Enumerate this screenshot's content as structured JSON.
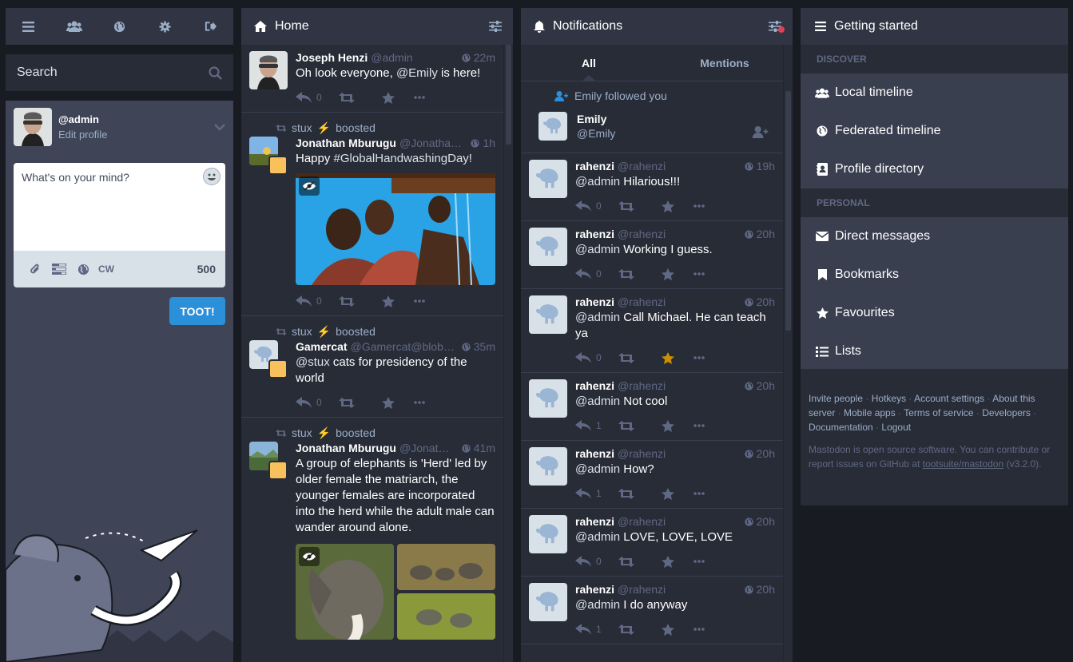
{
  "compose": {
    "search_placeholder": "Search",
    "account_username": "@admin",
    "edit_profile": "Edit profile",
    "textarea_placeholder": "What's on your mind?",
    "cw_label": "CW",
    "char_count": "500",
    "toot_label": "TOOT!"
  },
  "home": {
    "title": "Home",
    "statuses": [
      {
        "boost": null,
        "name": "Joseph Henzi",
        "acct": "@admin",
        "time": "22m",
        "content": "Oh look everyone, @Emily is here!",
        "replies": "0"
      },
      {
        "boost": "stux",
        "boosted_label": "boosted",
        "name": "Jonathan Mburugu",
        "acct": "@Jonathan…",
        "time": "1h",
        "content": "Happy #GlobalHandwashingDay!",
        "replies": "0"
      },
      {
        "boost": "stux",
        "boosted_label": "boosted",
        "name": "Gamercat",
        "acct": "@Gamercat@blob....",
        "time": "35m",
        "content": "@stux cats for presidency of the world",
        "replies": "0"
      },
      {
        "boost": "stux",
        "boosted_label": "boosted",
        "name": "Jonathan Mburugu",
        "acct": "@Jonath…",
        "time": "41m",
        "content": "A group of elephants is 'Herd' led by older female the matriarch, the younger females are incorporated into the herd while the adult male can wander around alone."
      }
    ]
  },
  "notifications": {
    "title": "Notifications",
    "tab_all": "All",
    "tab_mentions": "Mentions",
    "follow_text": "Emily followed you",
    "follower_name": "Emily",
    "follower_handle": "@Emily",
    "items": [
      {
        "name": "rahenzi",
        "acct": "@rahenzi",
        "time": "19h",
        "content": "@admin Hilarious!!!",
        "replies": "0",
        "fav": false
      },
      {
        "name": "rahenzi",
        "acct": "@rahenzi",
        "time": "20h",
        "content": "@admin Working I guess.",
        "replies": "0",
        "fav": false
      },
      {
        "name": "rahenzi",
        "acct": "@rahenzi",
        "time": "20h",
        "content": "@admin Call Michael. He can teach ya",
        "replies": "0",
        "fav": true
      },
      {
        "name": "rahenzi",
        "acct": "@rahenzi",
        "time": "20h",
        "content": "@admin Not cool",
        "replies": "1",
        "fav": false
      },
      {
        "name": "rahenzi",
        "acct": "@rahenzi",
        "time": "20h",
        "content": "@admin How?",
        "replies": "1",
        "fav": false
      },
      {
        "name": "rahenzi",
        "acct": "@rahenzi",
        "time": "20h",
        "content": "@admin LOVE, LOVE, LOVE",
        "replies": "0",
        "fav": false
      },
      {
        "name": "rahenzi",
        "acct": "@rahenzi",
        "time": "20h",
        "content": "@admin I do anyway",
        "replies": "1",
        "fav": false
      }
    ]
  },
  "getting_started": {
    "title": "Getting started",
    "discover_label": "Discover",
    "personal_label": "Personal",
    "discover": [
      "Local timeline",
      "Federated timeline",
      "Profile directory"
    ],
    "personal": [
      "Direct messages",
      "Bookmarks",
      "Favourites",
      "Lists"
    ],
    "footer_links": [
      "Invite people",
      "Hotkeys",
      "Account settings",
      "About this server",
      "Mobile apps",
      "Terms of service",
      "Developers",
      "Documentation",
      "Logout"
    ],
    "foss_text": "Mastodon is open source software. You can contribute or report issues on GitHub at",
    "repo": "tootsuite/mastodon",
    "version": "(v3.2.0)."
  },
  "colors": {
    "accent": "#2b90d9",
    "fav": "#ca8f04",
    "background": "#191b22",
    "column": "#282c37"
  }
}
